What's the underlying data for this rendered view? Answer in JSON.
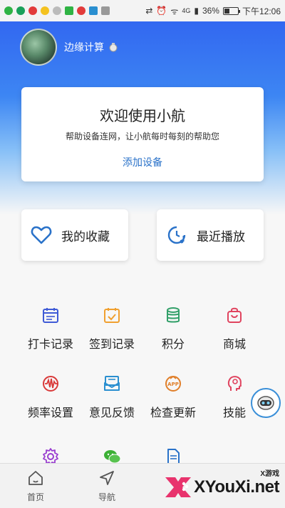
{
  "status_bar": {
    "battery": "36%",
    "time": "下午12:06",
    "network": "4G"
  },
  "profile": {
    "name": "边缘计算"
  },
  "welcome_card": {
    "title": "欢迎使用小航",
    "subtitle": "帮助设备连网，让小航每时每刻的帮助您",
    "link": "添加设备"
  },
  "shortcuts": [
    {
      "label": "我的收藏",
      "icon": "heart-icon"
    },
    {
      "label": "最近播放",
      "icon": "clock-music-icon"
    }
  ],
  "grid": [
    {
      "label": "打卡记录",
      "icon": "calendar-icon",
      "color": "#3f5bd6"
    },
    {
      "label": "签到记录",
      "icon": "checkin-calendar-icon",
      "color": "#f0a030"
    },
    {
      "label": "积分",
      "icon": "coins-icon",
      "color": "#33a06a"
    },
    {
      "label": "商城",
      "icon": "shopping-bag-icon",
      "color": "#e0445f"
    },
    {
      "label": "频率设置",
      "icon": "waveform-icon",
      "color": "#d93a3a"
    },
    {
      "label": "意见反馈",
      "icon": "feedback-mail-icon",
      "color": "#2a8fd0"
    },
    {
      "label": "检查更新",
      "icon": "app-update-icon",
      "color": "#e07f2a"
    },
    {
      "label": "技能",
      "icon": "head-skill-icon",
      "color": "#e0445f"
    },
    {
      "label": "",
      "icon": "settings-gear-icon",
      "color": "#9a3fd0"
    },
    {
      "label": "",
      "icon": "wechat-icon",
      "color": "#3cb035"
    },
    {
      "label": "",
      "icon": "document-icon",
      "color": "#2a72c9"
    }
  ],
  "bottom_nav": [
    {
      "label": "首页",
      "icon": "home-icon"
    },
    {
      "label": "导航",
      "icon": "navigation-icon"
    }
  ],
  "watermark": {
    "top": "X游戏",
    "main": "XYouXi.net"
  }
}
